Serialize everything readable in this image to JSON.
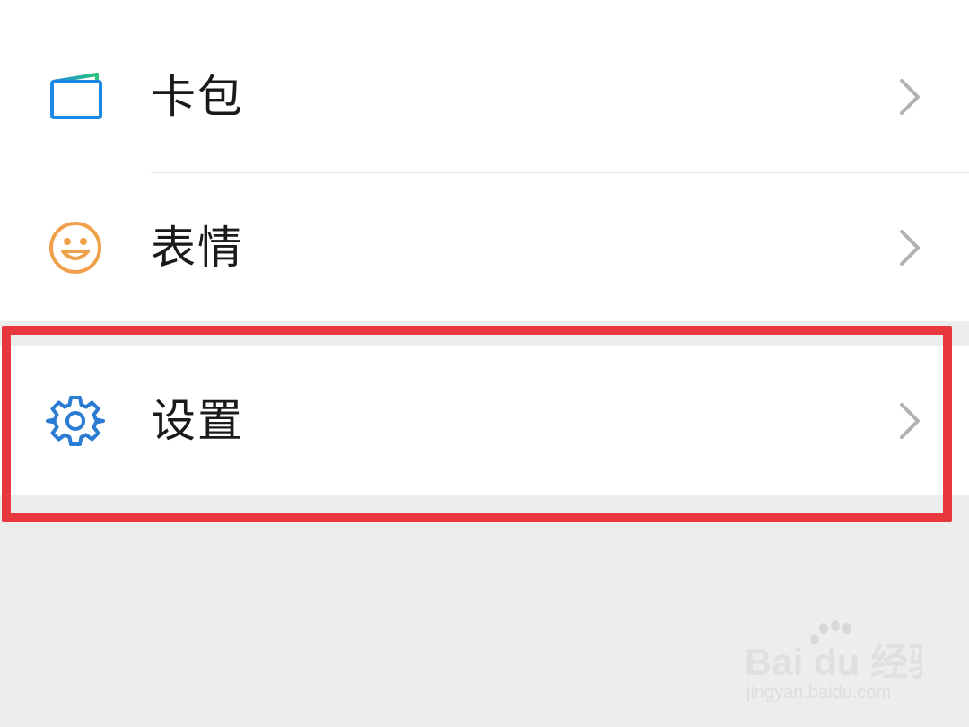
{
  "menu": {
    "items": [
      {
        "label": "卡包",
        "icon": "card-wallet-icon",
        "icon_color": "#1e88e5"
      },
      {
        "label": "表情",
        "icon": "smiley-face-icon",
        "icon_color": "#f0a04b"
      },
      {
        "label": "设置",
        "icon": "gear-icon",
        "icon_color": "#2b7cd3"
      }
    ]
  },
  "highlight": {
    "color": "#e8383d"
  },
  "watermark": {
    "brand": "Bai du 经验",
    "url": "jingyan.baidu.com"
  }
}
